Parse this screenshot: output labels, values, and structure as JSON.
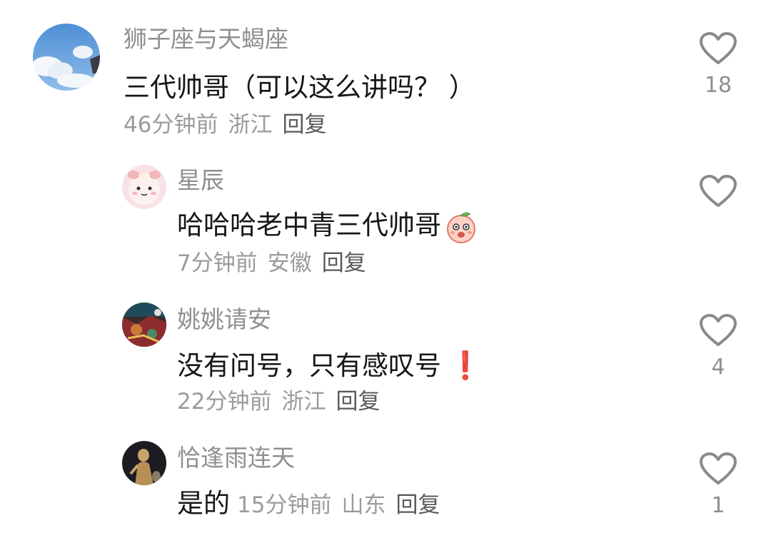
{
  "comments": [
    {
      "username": "狮子座与天蝎座",
      "content": "三代帅哥（可以这么讲吗？ ）",
      "time": "46分钟前",
      "location": "浙江",
      "reply": "回复",
      "likes": "18",
      "avatar": "sky-clouds"
    },
    {
      "username": "星辰",
      "content": "哈哈哈老中青三代帅哥",
      "time": "7分钟前",
      "location": "安徽",
      "reply": "回复",
      "likes": "",
      "avatar": "pink-cartoon",
      "emoji": "peach-face-emoji"
    },
    {
      "username": "姚姚请安",
      "content": "没有问号，只有感叹号",
      "time": "22分钟前",
      "location": "浙江",
      "reply": "回复",
      "likes": "4",
      "avatar": "colorful-art",
      "emoji": "exclamation-emoji",
      "emoji_text": "❗"
    },
    {
      "username": "恰逢雨连天",
      "content": "是的",
      "time": "15分钟前",
      "location": "山东",
      "reply": "回复",
      "likes": "1",
      "avatar": "golden-statue"
    }
  ],
  "colors": {
    "username": "#8f8f8f",
    "content": "#161616",
    "meta": "#9b9b9b",
    "reply": "#5a5a5a",
    "heart": "#8a8a8a",
    "exclamation": "#e0413b"
  }
}
